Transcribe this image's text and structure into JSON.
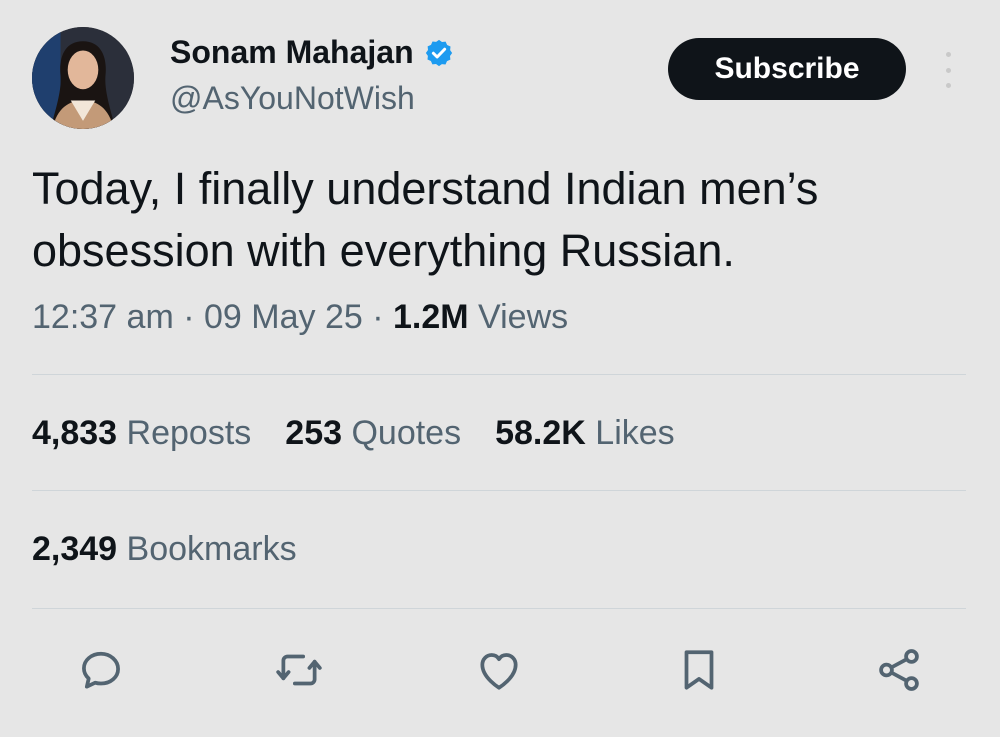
{
  "author": {
    "name": "Sonam Mahajan",
    "handle": "@AsYouNotWish",
    "verified_icon": "verified-badge-icon",
    "verified_color": "#1d9bf0"
  },
  "subscribe_label": "Subscribe",
  "tweet": {
    "text_line1": "Today, I finally understand Indian men’s",
    "text_line2": "obsession with everything Russian."
  },
  "meta": {
    "time": "12:37 am",
    "sep1": "·",
    "date": "09 May 25",
    "sep2": "·",
    "views_count": "1.2M",
    "views_label": "Views"
  },
  "stats": {
    "reposts": {
      "count": "4,833",
      "label": "Reposts"
    },
    "quotes": {
      "count": "253",
      "label": "Quotes"
    },
    "likes": {
      "count": "58.2K",
      "label": "Likes"
    },
    "bookmarks": {
      "count": "2,349",
      "label": "Bookmarks"
    }
  },
  "actions": [
    "reply-icon",
    "retweet-icon",
    "like-icon",
    "bookmark-icon",
    "share-icon"
  ],
  "colors": {
    "background": "#e6e6e6",
    "text_primary": "#0f1419",
    "text_secondary": "#536471",
    "button_bg": "#0f1419"
  }
}
